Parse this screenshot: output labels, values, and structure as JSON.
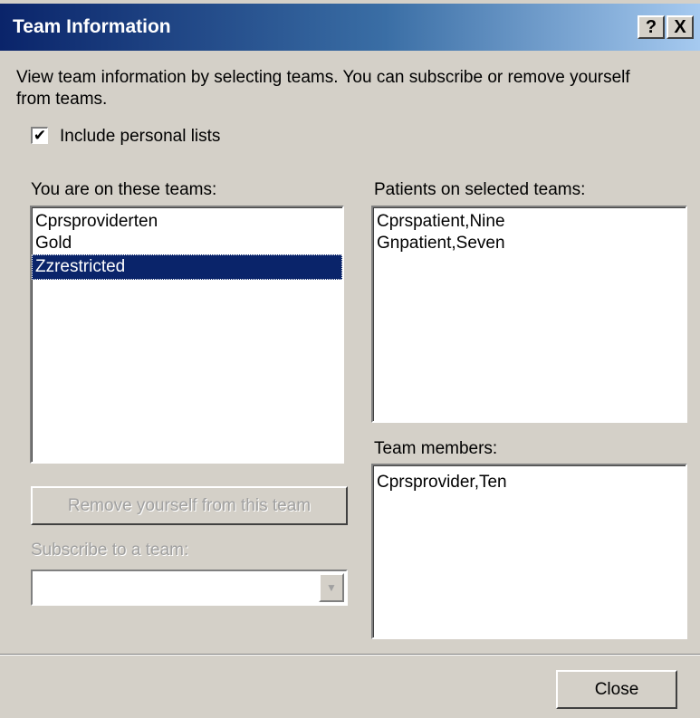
{
  "window": {
    "title": "Team Information",
    "help_label": "?",
    "close_label": "X"
  },
  "description": "View team information by selecting teams. You can subscribe or remove yourself from teams.",
  "include_personal": {
    "label": "Include personal lists",
    "checked": true,
    "check_glyph": "✔"
  },
  "teams": {
    "label": "You are on these teams:",
    "items": [
      "Cprsproviderten",
      "Gold",
      "Zzrestricted"
    ],
    "selected_index": 2
  },
  "patients": {
    "label": "Patients on selected teams:",
    "items": [
      "Cprspatient,Nine",
      "Gnpatient,Seven"
    ]
  },
  "members": {
    "label": "Team members:",
    "items": [
      "Cprsprovider,Ten"
    ]
  },
  "remove_button": {
    "label": "Remove yourself from this team",
    "enabled": false
  },
  "subscribe": {
    "label": "Subscribe to a team:",
    "value": "",
    "arrow_glyph": "▼",
    "enabled": false
  },
  "close_button": {
    "label": "Close"
  },
  "colors": {
    "selection": "#0a246a",
    "face": "#d4d0c8"
  }
}
